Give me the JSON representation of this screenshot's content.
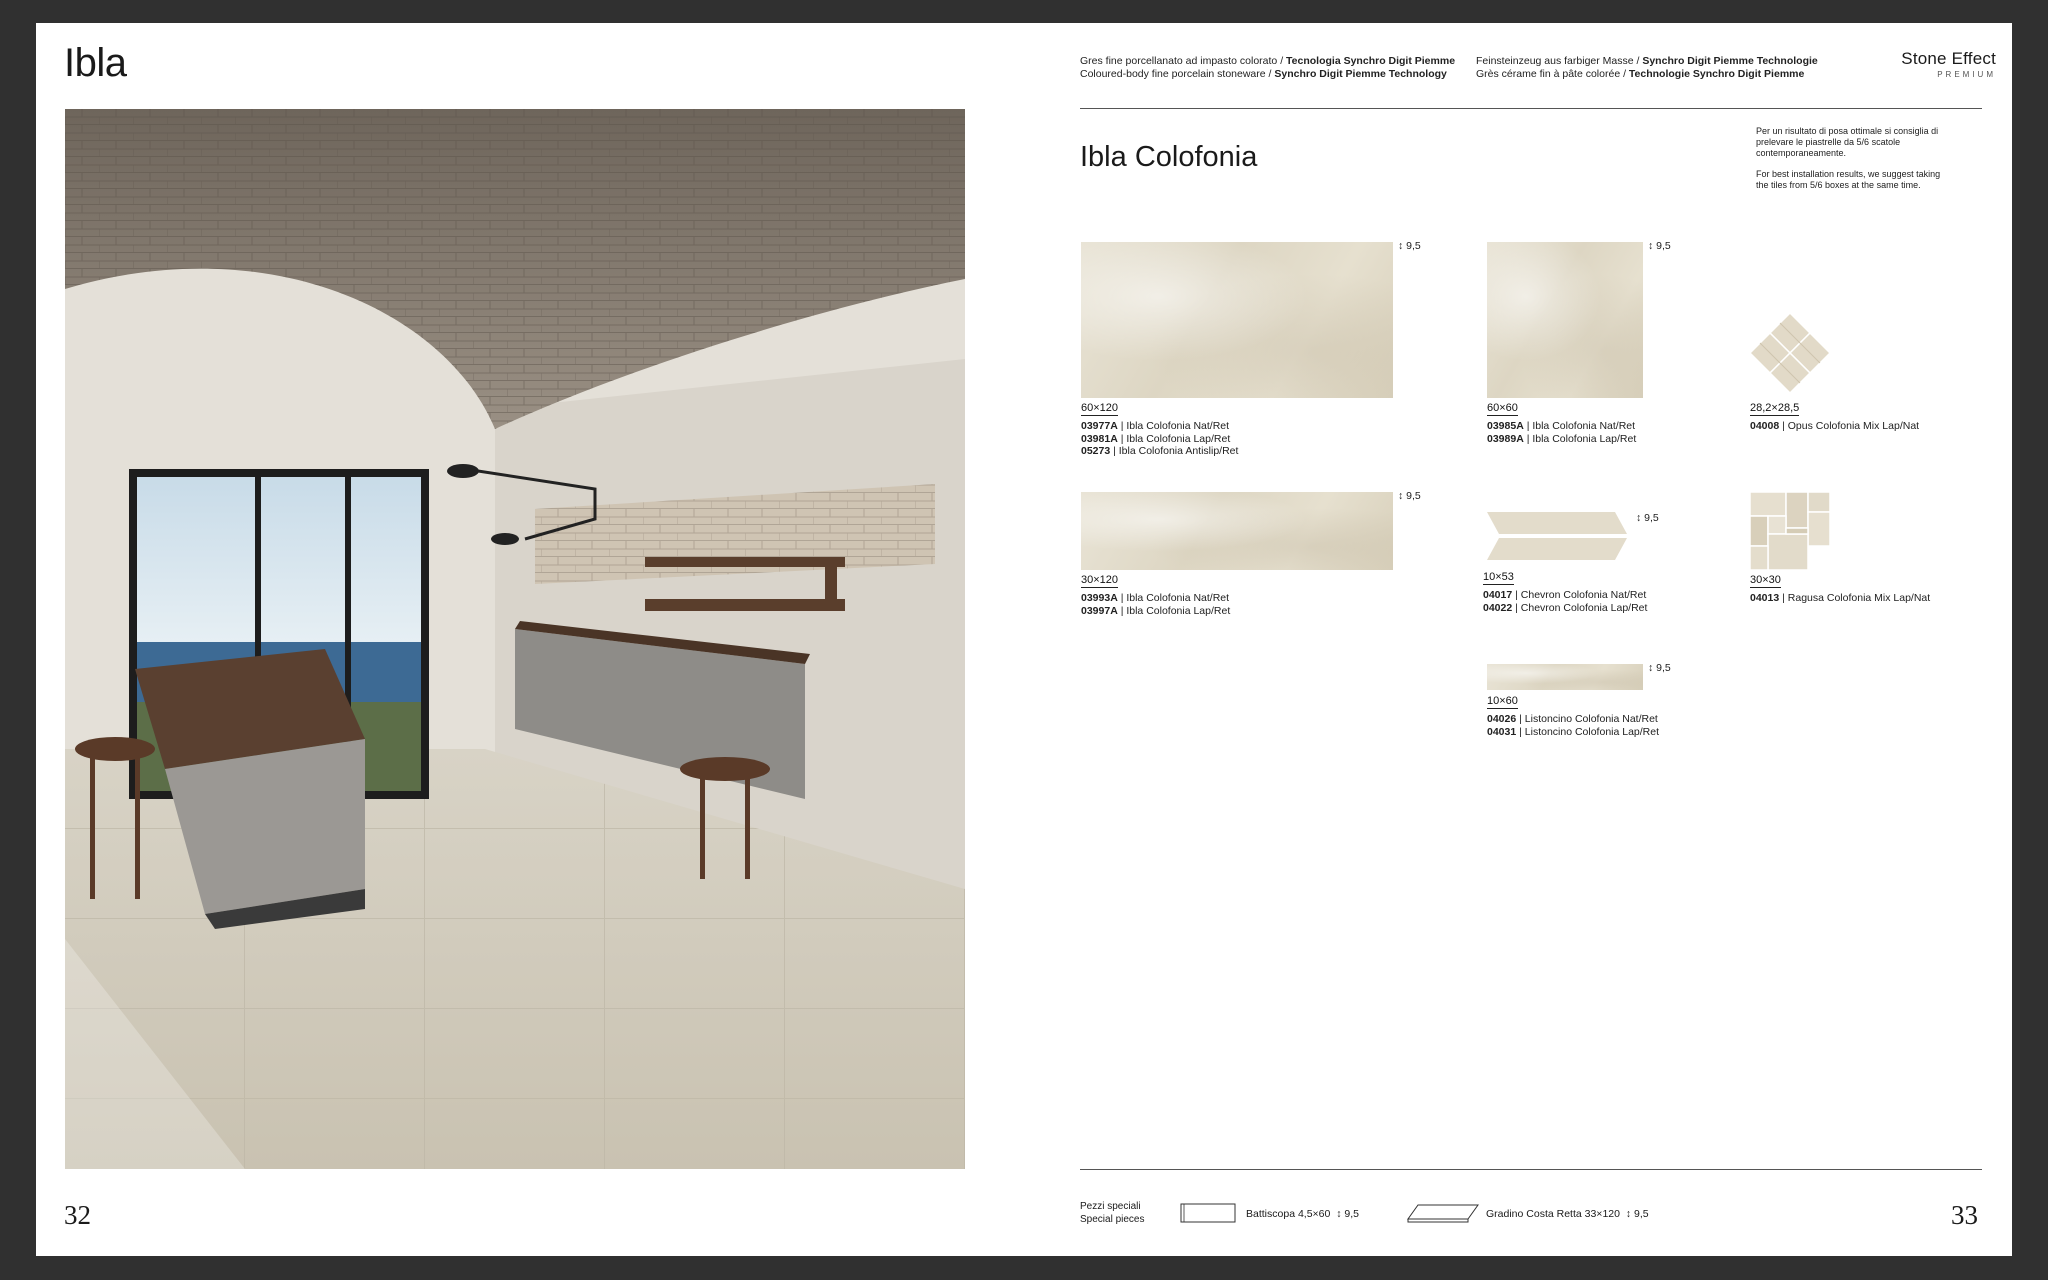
{
  "left_page": {
    "title": "Ibla",
    "page_number": "32"
  },
  "header": {
    "col1_line1_normal": "Gres fine porcellanato ad impasto colorato / ",
    "col1_line1_bold": "Tecnologia Synchro Digit Piemme",
    "col1_line2_normal": "Coloured-body fine porcelain stoneware / ",
    "col1_line2_bold": "Synchro Digit Piemme Technology",
    "col2_line1_normal": "Feinsteinzeug aus farbiger Masse / ",
    "col2_line1_bold": "Synchro Digit Piemme Technologie",
    "col2_line2_normal": "Grès cérame fin à pâte colorée / ",
    "col2_line2_bold": "Technologie Synchro Digit Piemme",
    "brand_main": "Stone Effect",
    "brand_sub": "PREMIUM"
  },
  "product": {
    "title": "Ibla Colofonia",
    "note_it": "Per un risultato di posa ottimale si consiglia di prelevare le piastrelle da 5/6 scatole contemporaneamente.",
    "note_en": "For best installation results, we suggest taking the tiles from 5/6 boxes at the same time."
  },
  "tiles": [
    {
      "size": "60×120",
      "thickness": "9,5",
      "codes": [
        {
          "code": "03977A",
          "name": " | Ibla Colofonia Nat/Ret"
        },
        {
          "code": "03981A",
          "name": " | Ibla Colofonia Lap/Ret"
        },
        {
          "code": "05273",
          "name": " | Ibla Colofonia Antislip/Ret"
        }
      ]
    },
    {
      "size": "60×60",
      "thickness": "9,5",
      "codes": [
        {
          "code": "03985A",
          "name": " | Ibla Colofonia Nat/Ret"
        },
        {
          "code": "03989A",
          "name": " | Ibla Colofonia Lap/Ret"
        }
      ]
    },
    {
      "size": "28,2×28,5",
      "codes": [
        {
          "code": "04008",
          "name": " | Opus Colofonia Mix Lap/Nat"
        }
      ]
    },
    {
      "size": "30×120",
      "thickness": "9,5",
      "codes": [
        {
          "code": "03993A",
          "name": " | Ibla Colofonia Nat/Ret"
        },
        {
          "code": "03997A",
          "name": " | Ibla Colofonia Lap/Ret"
        }
      ]
    },
    {
      "size": "10×53",
      "thickness": "9,5",
      "codes": [
        {
          "code": "04017",
          "name": " | Chevron Colofonia Nat/Ret"
        },
        {
          "code": "04022",
          "name": " | Chevron Colofonia Lap/Ret"
        }
      ]
    },
    {
      "size": "30×30",
      "codes": [
        {
          "code": "04013",
          "name": " | Ragusa Colofonia Mix Lap/Nat"
        }
      ]
    },
    {
      "size": "10×60",
      "thickness": "9,5",
      "codes": [
        {
          "code": "04026",
          "name": " | Listoncino Colofonia Nat/Ret"
        },
        {
          "code": "04031",
          "name": " | Listoncino Colofonia Lap/Ret"
        }
      ]
    }
  ],
  "footer": {
    "label_line1": "Pezzi speciali",
    "label_line2": "Special pieces",
    "piece1_name": "Battiscopa 4,5×60",
    "piece1_thickness": "9,5",
    "piece2_name": "Gradino Costa Retta 33×120",
    "piece2_thickness": "9,5",
    "page_number": "33"
  }
}
